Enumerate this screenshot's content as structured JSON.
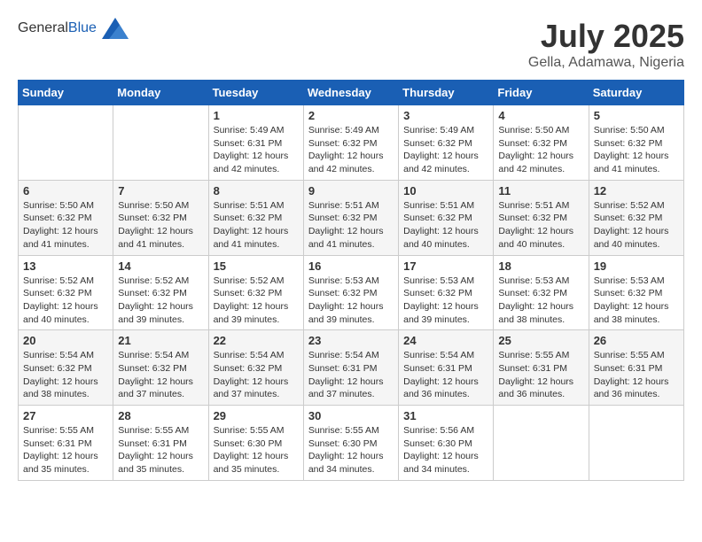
{
  "header": {
    "logo_general": "General",
    "logo_blue": "Blue",
    "month": "July 2025",
    "location": "Gella, Adamawa, Nigeria"
  },
  "weekdays": [
    "Sunday",
    "Monday",
    "Tuesday",
    "Wednesday",
    "Thursday",
    "Friday",
    "Saturday"
  ],
  "weeks": [
    [
      {
        "day": "",
        "info": ""
      },
      {
        "day": "",
        "info": ""
      },
      {
        "day": "1",
        "info": "Sunrise: 5:49 AM\nSunset: 6:31 PM\nDaylight: 12 hours and 42 minutes."
      },
      {
        "day": "2",
        "info": "Sunrise: 5:49 AM\nSunset: 6:32 PM\nDaylight: 12 hours and 42 minutes."
      },
      {
        "day": "3",
        "info": "Sunrise: 5:49 AM\nSunset: 6:32 PM\nDaylight: 12 hours and 42 minutes."
      },
      {
        "day": "4",
        "info": "Sunrise: 5:50 AM\nSunset: 6:32 PM\nDaylight: 12 hours and 42 minutes."
      },
      {
        "day": "5",
        "info": "Sunrise: 5:50 AM\nSunset: 6:32 PM\nDaylight: 12 hours and 41 minutes."
      }
    ],
    [
      {
        "day": "6",
        "info": "Sunrise: 5:50 AM\nSunset: 6:32 PM\nDaylight: 12 hours and 41 minutes."
      },
      {
        "day": "7",
        "info": "Sunrise: 5:50 AM\nSunset: 6:32 PM\nDaylight: 12 hours and 41 minutes."
      },
      {
        "day": "8",
        "info": "Sunrise: 5:51 AM\nSunset: 6:32 PM\nDaylight: 12 hours and 41 minutes."
      },
      {
        "day": "9",
        "info": "Sunrise: 5:51 AM\nSunset: 6:32 PM\nDaylight: 12 hours and 41 minutes."
      },
      {
        "day": "10",
        "info": "Sunrise: 5:51 AM\nSunset: 6:32 PM\nDaylight: 12 hours and 40 minutes."
      },
      {
        "day": "11",
        "info": "Sunrise: 5:51 AM\nSunset: 6:32 PM\nDaylight: 12 hours and 40 minutes."
      },
      {
        "day": "12",
        "info": "Sunrise: 5:52 AM\nSunset: 6:32 PM\nDaylight: 12 hours and 40 minutes."
      }
    ],
    [
      {
        "day": "13",
        "info": "Sunrise: 5:52 AM\nSunset: 6:32 PM\nDaylight: 12 hours and 40 minutes."
      },
      {
        "day": "14",
        "info": "Sunrise: 5:52 AM\nSunset: 6:32 PM\nDaylight: 12 hours and 39 minutes."
      },
      {
        "day": "15",
        "info": "Sunrise: 5:52 AM\nSunset: 6:32 PM\nDaylight: 12 hours and 39 minutes."
      },
      {
        "day": "16",
        "info": "Sunrise: 5:53 AM\nSunset: 6:32 PM\nDaylight: 12 hours and 39 minutes."
      },
      {
        "day": "17",
        "info": "Sunrise: 5:53 AM\nSunset: 6:32 PM\nDaylight: 12 hours and 39 minutes."
      },
      {
        "day": "18",
        "info": "Sunrise: 5:53 AM\nSunset: 6:32 PM\nDaylight: 12 hours and 38 minutes."
      },
      {
        "day": "19",
        "info": "Sunrise: 5:53 AM\nSunset: 6:32 PM\nDaylight: 12 hours and 38 minutes."
      }
    ],
    [
      {
        "day": "20",
        "info": "Sunrise: 5:54 AM\nSunset: 6:32 PM\nDaylight: 12 hours and 38 minutes."
      },
      {
        "day": "21",
        "info": "Sunrise: 5:54 AM\nSunset: 6:32 PM\nDaylight: 12 hours and 37 minutes."
      },
      {
        "day": "22",
        "info": "Sunrise: 5:54 AM\nSunset: 6:32 PM\nDaylight: 12 hours and 37 minutes."
      },
      {
        "day": "23",
        "info": "Sunrise: 5:54 AM\nSunset: 6:31 PM\nDaylight: 12 hours and 37 minutes."
      },
      {
        "day": "24",
        "info": "Sunrise: 5:54 AM\nSunset: 6:31 PM\nDaylight: 12 hours and 36 minutes."
      },
      {
        "day": "25",
        "info": "Sunrise: 5:55 AM\nSunset: 6:31 PM\nDaylight: 12 hours and 36 minutes."
      },
      {
        "day": "26",
        "info": "Sunrise: 5:55 AM\nSunset: 6:31 PM\nDaylight: 12 hours and 36 minutes."
      }
    ],
    [
      {
        "day": "27",
        "info": "Sunrise: 5:55 AM\nSunset: 6:31 PM\nDaylight: 12 hours and 35 minutes."
      },
      {
        "day": "28",
        "info": "Sunrise: 5:55 AM\nSunset: 6:31 PM\nDaylight: 12 hours and 35 minutes."
      },
      {
        "day": "29",
        "info": "Sunrise: 5:55 AM\nSunset: 6:30 PM\nDaylight: 12 hours and 35 minutes."
      },
      {
        "day": "30",
        "info": "Sunrise: 5:55 AM\nSunset: 6:30 PM\nDaylight: 12 hours and 34 minutes."
      },
      {
        "day": "31",
        "info": "Sunrise: 5:56 AM\nSunset: 6:30 PM\nDaylight: 12 hours and 34 minutes."
      },
      {
        "day": "",
        "info": ""
      },
      {
        "day": "",
        "info": ""
      }
    ]
  ]
}
